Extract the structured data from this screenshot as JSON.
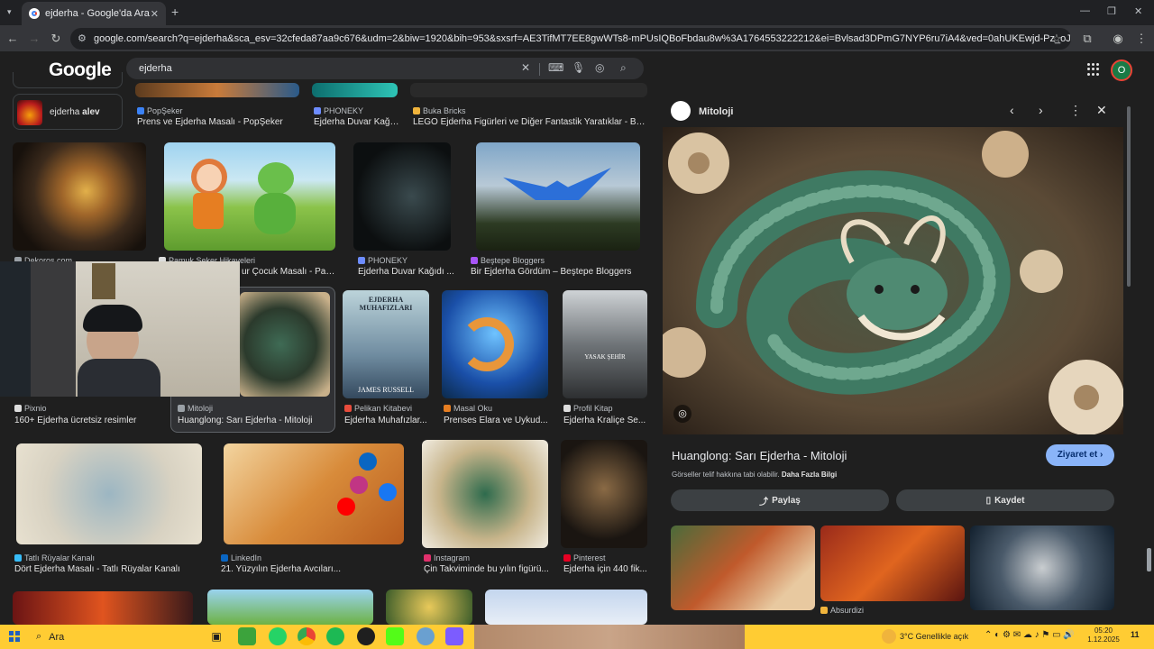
{
  "browser": {
    "tab_title": "ejderha - Google'da Ara",
    "url": "google.com/search?q=ejderha&sca_esv=32cfeda87aa9c676&udm=2&biw=1920&bih=953&sxsrf=AE3TifMT7EE8gwWTs8-mPUsIQBoFbdau8w%3A1764553222212&ei=Bvlsad3DPmG7NYP6ru7iA4&ved=0ahUKEwjd-Pz_oJURAxV5A9sEHerdDuEQ4dUDCBE..."
  },
  "google": {
    "logo": "Google",
    "query": "ejderha",
    "avatar_letter": "O"
  },
  "related_chip": {
    "prefix": "ejderha",
    "bold": "alev"
  },
  "results": {
    "row0": [
      {
        "source": "PopŞeker",
        "title": "Prens ve Ejderha Masalı - PopŞeker",
        "color": "#3b82f6"
      },
      {
        "source": "PHONEKY",
        "title": "Ejderha Duvar Kağı...",
        "color": "#6d8cff"
      },
      {
        "source": "Buka Bricks",
        "title": "LEGO Ejderha Figürleri ve Diğer Fantastik Yaratıklar - Buk...",
        "color": "#f0b43c"
      }
    ],
    "row1": [
      {
        "source": "Dekoros.com",
        "title": "",
        "color": "#9aa0a6"
      },
      {
        "source": "Pamuk Şeker Hikayeleri",
        "title": "ur Çocuk Masalı - Pam...",
        "color": "#ddd"
      },
      {
        "source": "PHONEKY",
        "title": "Ejderha Duvar Kağıdı ...",
        "color": "#6d8cff"
      },
      {
        "source": "Beştepe Bloggers",
        "title": "Bir Ejderha Gördüm – Beştepe Bloggers",
        "color": "#a855f7"
      }
    ],
    "row2": [
      {
        "source": "Pixnio",
        "title": "160+ Ejderha ücretsiz resimler",
        "color": "#ddd"
      },
      {
        "source": "Mitoloji",
        "title": "Huanglong: Sarı Ejderha - Mitoloji",
        "color": "#9aa0a6"
      },
      {
        "source": "Pelikan Kitabevi",
        "title": "Ejderha Muhafızlar...",
        "color": "#e74c3c"
      },
      {
        "source": "Masal Oku",
        "title": "Prenses Elara ve Uykud...",
        "color": "#e67e22"
      },
      {
        "source": "Profil Kitap",
        "title": "Ejderha Kraliçe Se...",
        "color": "#ddd"
      }
    ],
    "row3": [
      {
        "source": "Tatlı Rüyalar Kanalı",
        "title": "Dört Ejderha Masalı - Tatlı Rüyalar Kanalı",
        "color": "#38bdf8"
      },
      {
        "source": "LinkedIn",
        "title": "21. Yüzyılın Ejderha Avcıları...",
        "color": "#0a66c2"
      },
      {
        "source": "Instagram",
        "title": "Çin Takviminde bu yılın figürü...",
        "color": "#e1306c"
      },
      {
        "source": "Pinterest",
        "title": "Ejderha için 440 fik...",
        "color": "#e60023"
      }
    ],
    "book_cover_text": "EJDERHA MUHAFIZLARI",
    "book_author": "JAMES RUSSELL",
    "book2_text": "YASAK ŞEHİR"
  },
  "panel": {
    "site": "Mitoloji",
    "title": "Huanglong: Sarı Ejderha - Mitoloji",
    "visit": "Ziyaret et",
    "notice": "Görseller telif hakkına tabi olabilir.",
    "more_info": "Daha Fazla Bilgi",
    "share": "Paylaş",
    "save": "Kaydet",
    "related_source": "Absurdizi"
  },
  "taskbar": {
    "search": "Ara",
    "weather": "3°C  Genellikle açık",
    "time": "05:20",
    "date": "1.12.2025",
    "badge": "11"
  }
}
